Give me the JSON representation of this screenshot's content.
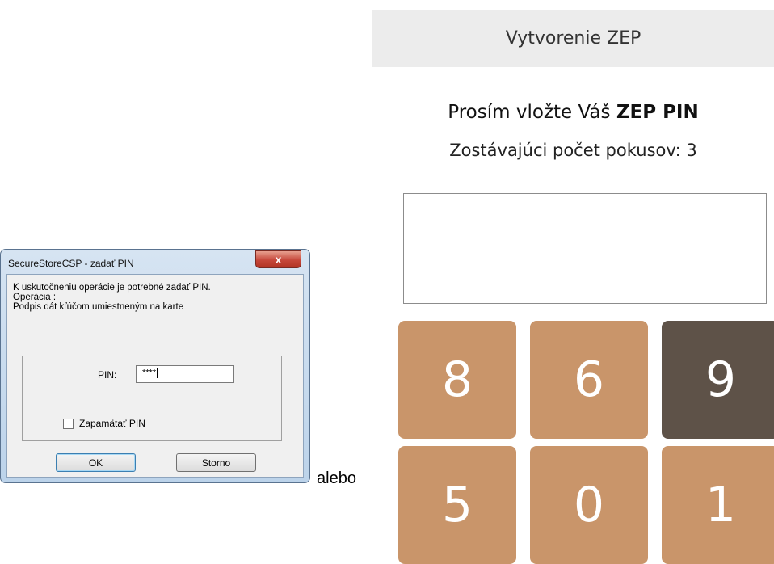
{
  "zep_panel": {
    "header": "Vytvorenie ZEP",
    "prompt_prefix": "Prosím vložte Váš",
    "prompt_bold": "ZEP PIN",
    "attempts_label": "Zostávajúci počet pokusov: 3",
    "keypad": [
      "8",
      "6",
      "9",
      "5",
      "0",
      "1"
    ]
  },
  "dialog": {
    "title": "SecureStoreCSP - zadať PIN",
    "close_glyph": "x",
    "message_line1": "K uskutočneniu operácie je potrebné zadať PIN.",
    "message_line2": "Operácia :",
    "message_line3": "Podpis dát kľúčom umiestneným na karte",
    "pin_label": "PIN:",
    "pin_value": "****",
    "remember_label": "Zapamätať PIN",
    "ok_label": "OK",
    "cancel_label": "Storno"
  },
  "separator_text": "alebo",
  "colors": {
    "key_tan": "#c9956a",
    "key_dark": "#5e5248",
    "header_bg": "#ececec"
  }
}
